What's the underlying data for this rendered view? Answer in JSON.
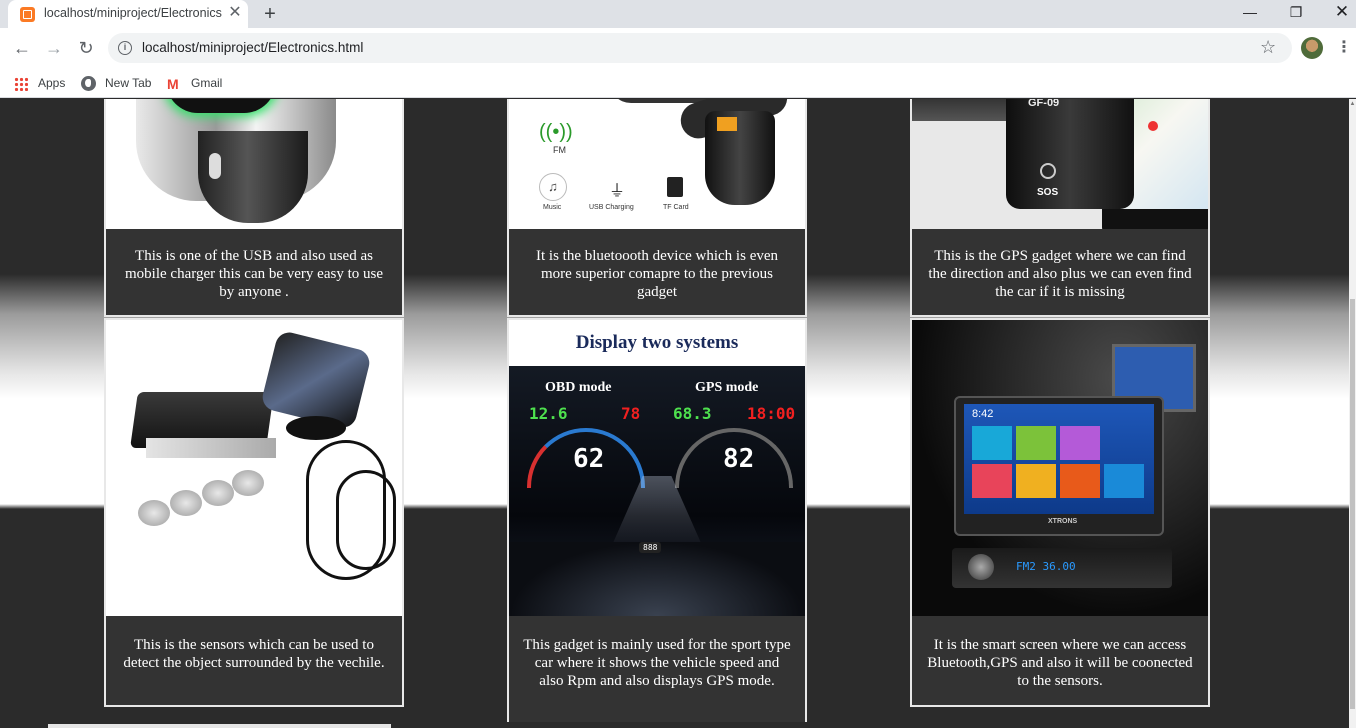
{
  "browser": {
    "tab_title": "localhost/miniproject/Electronics",
    "tab_close": "✕",
    "new_tab": "+",
    "url": "localhost/miniproject/Electronics.html",
    "window_controls": {
      "minimize": "—",
      "maximize": "❐",
      "close": "✕"
    },
    "bookmarks": [
      {
        "label": "Apps",
        "icon": "apps-grid-icon"
      },
      {
        "label": "New Tab",
        "icon": "globe-icon"
      },
      {
        "label": "Gmail",
        "icon": "gmail-icon"
      }
    ]
  },
  "products": [
    {
      "description": "This is one of the USB and also used as mobile charger this can be very easy to use by anyone .",
      "image": "usb-car-charger"
    },
    {
      "description": "It is the bluetoooth device which is even more superior comapre to the previous gadget",
      "image": "bluetooth-fm-transmitter",
      "image_text": {
        "fm": "FM",
        "music": "Music",
        "usb": "USB Charging",
        "tf": "TF Card"
      }
    },
    {
      "description": "This is the GPS gadget where we can find the direction and also plus we can even find the car if it is missing",
      "image": "gps-tracker",
      "image_text": {
        "model": "GF-09",
        "sos": "SOS"
      }
    },
    {
      "description": "This is the sensors which can be used to detect the object surrounded by the vechile.",
      "image": "parking-sensors"
    },
    {
      "description": "This gadget is mainly used for the sport type car where it shows the vehicle speed and also Rpm and also displays GPS mode.",
      "image": "hud-display",
      "image_text": {
        "title": "Display two systems",
        "left_mode": "OBD mode",
        "right_mode": "GPS mode",
        "left_small": "12.6",
        "left_red": "78",
        "right_small": "68.3",
        "right_red": "18:00",
        "left_big": "62",
        "right_big": "82",
        "base": "888"
      }
    },
    {
      "description": "It is the smart screen where we can access Bluetooth,GPS and also it will be coonected to the sensors.",
      "image": "smart-screen",
      "image_text": {
        "time": "8:42",
        "brand": "XTRONS",
        "radio": "FM2 36.00"
      }
    }
  ]
}
